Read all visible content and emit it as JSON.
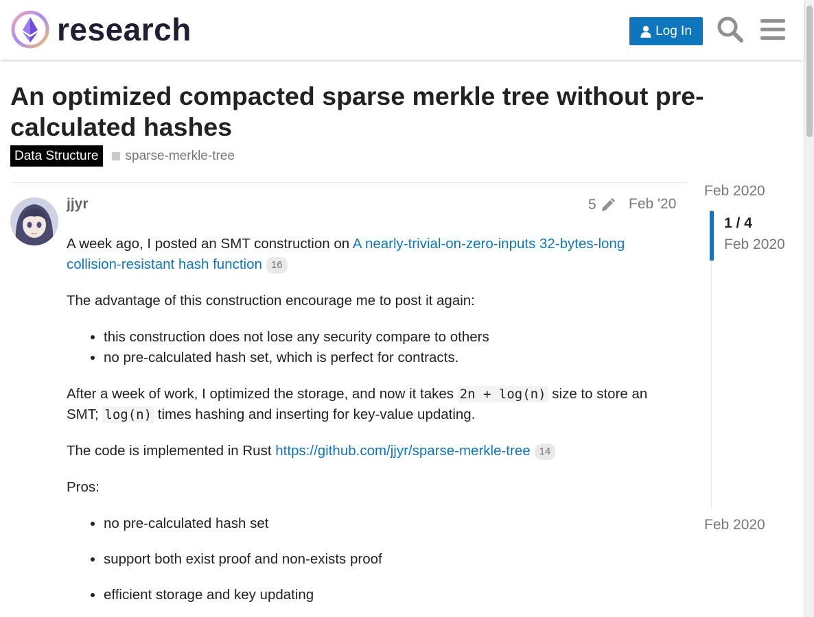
{
  "header": {
    "logo_text": "research",
    "login_label": "Log In",
    "icons": [
      "ethereum-logo-icon",
      "user-icon",
      "search-icon",
      "hamburger-menu-icon"
    ]
  },
  "topic": {
    "title": "An optimized compacted sparse merkle tree without pre-calculated hashes",
    "category": "Data Structure",
    "tag": "sparse-merkle-tree"
  },
  "post": {
    "username": "jjyr",
    "edit_count": "5",
    "date": "Feb '20",
    "p1_text": "A week ago, I posted an SMT construction on ",
    "p1_link": "A nearly-trivial-on-zero-inputs 32-bytes-long collision-resistant hash function",
    "p1_badge": "16",
    "p2": "The advantage of this construction encourage me to post it again:",
    "list1": [
      "this construction does not lose any security compare to others",
      "no pre-calculated hash set, which is perfect for contracts."
    ],
    "p3_a": "After a week of work, I optimized the storage, and now it takes ",
    "p3_code1": "2n + log(n)",
    "p3_b": " size to store an SMT; ",
    "p3_code2": "log(n)",
    "p3_c": " times hashing and inserting for key-value updating.",
    "p4_text": "The code is implemented in Rust ",
    "p4_link": "https://github.com/jjyr/sparse-merkle-tree",
    "p4_badge": "14",
    "p5": "Pros:",
    "pros": [
      "no pre-calculated hash set",
      "support both exist proof and non-exists proof",
      "efficient storage and key updating"
    ]
  },
  "timeline": {
    "start_date": "Feb 2020",
    "position": "1 / 4",
    "position_date": "Feb 2020",
    "end_date": "Feb 2020"
  },
  "colors": {
    "accent": "#0e76bd",
    "category_bg": "#000000",
    "muted_text": "#777777"
  }
}
